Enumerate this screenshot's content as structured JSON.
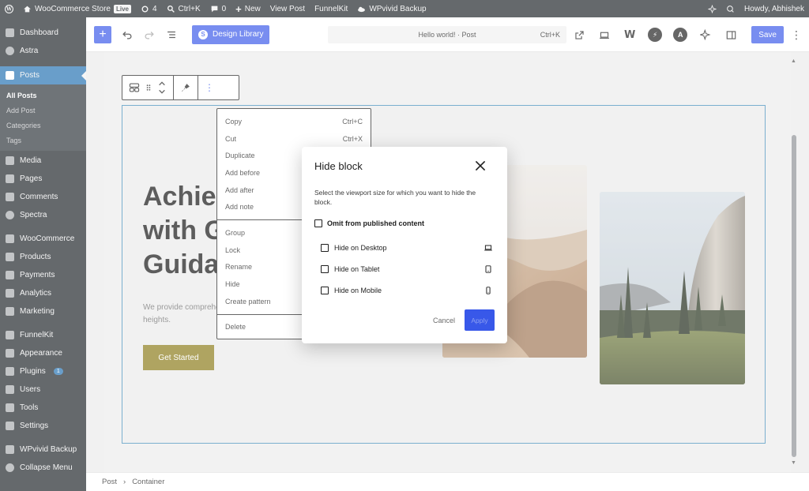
{
  "admin_bar": {
    "site_name": "WooCommerce Store",
    "live_label": "Live",
    "updates_count": "4",
    "search_shortcut": "Ctrl+K",
    "comments_count": "0",
    "new_label": "New",
    "view_post": "View Post",
    "funnelkit": "FunnelKit",
    "wpvivid": "WPvivid Backup",
    "howdy": "Howdy, Abhishek"
  },
  "sidebar": {
    "items": [
      {
        "label": "Dashboard",
        "icon": "dashboard-icon"
      },
      {
        "label": "Astra",
        "icon": "astra-icon"
      },
      {
        "label": "Posts",
        "icon": "pin-icon",
        "active": true
      },
      {
        "label": "Media",
        "icon": "media-icon"
      },
      {
        "label": "Pages",
        "icon": "pages-icon"
      },
      {
        "label": "Comments",
        "icon": "comments-icon"
      },
      {
        "label": "Spectra",
        "icon": "spectra-icon"
      },
      {
        "label": "WooCommerce",
        "icon": "woocommerce-icon"
      },
      {
        "label": "Products",
        "icon": "products-icon"
      },
      {
        "label": "Payments",
        "icon": "payments-icon"
      },
      {
        "label": "Analytics",
        "icon": "analytics-icon"
      },
      {
        "label": "Marketing",
        "icon": "marketing-icon"
      },
      {
        "label": "FunnelKit",
        "icon": "funnelkit-icon"
      },
      {
        "label": "Appearance",
        "icon": "appearance-icon"
      },
      {
        "label": "Plugins",
        "icon": "plugins-icon",
        "badge": "1"
      },
      {
        "label": "Users",
        "icon": "users-icon"
      },
      {
        "label": "Tools",
        "icon": "tools-icon"
      },
      {
        "label": "Settings",
        "icon": "settings-icon"
      },
      {
        "label": "WPvivid Backup",
        "icon": "wpvivid-icon"
      },
      {
        "label": "Collapse Menu",
        "icon": "collapse-icon"
      }
    ],
    "posts_submenu": [
      "All Posts",
      "Add Post",
      "Categories",
      "Tags"
    ]
  },
  "editor_header": {
    "design_library": "Design Library",
    "command_bar": "Hello world! · Post",
    "command_shortcut": "Ctrl+K",
    "save": "Save"
  },
  "content": {
    "hero_title_lines": [
      "Achie",
      "with G",
      "Guida"
    ],
    "hero_sub_lines": [
      "We provide comprehe",
      "heights."
    ],
    "cta": "Get Started"
  },
  "context_menu": {
    "sections": [
      [
        {
          "label": "Copy",
          "shortcut": "Ctrl+C"
        },
        {
          "label": "Cut",
          "shortcut": "Ctrl+X"
        },
        {
          "label": "Duplicate",
          "shortcut": ""
        },
        {
          "label": "Add before",
          "shortcut": ""
        },
        {
          "label": "Add after",
          "shortcut": ""
        },
        {
          "label": "Add note",
          "shortcut": ""
        }
      ],
      [
        {
          "label": "Group",
          "shortcut": ""
        },
        {
          "label": "Lock",
          "shortcut": ""
        },
        {
          "label": "Rename",
          "shortcut": ""
        },
        {
          "label": "Hide",
          "shortcut": ""
        },
        {
          "label": "Create pattern",
          "shortcut": ""
        }
      ],
      [
        {
          "label": "Delete",
          "shortcut": ""
        }
      ]
    ]
  },
  "modal": {
    "title": "Hide block",
    "description": "Select the viewport size for which you want to hide the block.",
    "omit_label": "Omit from published content",
    "options": [
      {
        "label": "Hide on Desktop",
        "icon": "laptop-icon"
      },
      {
        "label": "Hide on Tablet",
        "icon": "tablet-icon"
      },
      {
        "label": "Hide on Mobile",
        "icon": "mobile-icon"
      }
    ],
    "cancel": "Cancel",
    "apply": "Apply"
  },
  "footer": {
    "breadcrumb": [
      "Post",
      "Container"
    ]
  },
  "colors": {
    "accent": "#3858e9",
    "admin_dark": "#1d2327",
    "menu_active": "#2271b1",
    "cta": "#8a7a17",
    "block_outline": "#3b8ab8"
  }
}
